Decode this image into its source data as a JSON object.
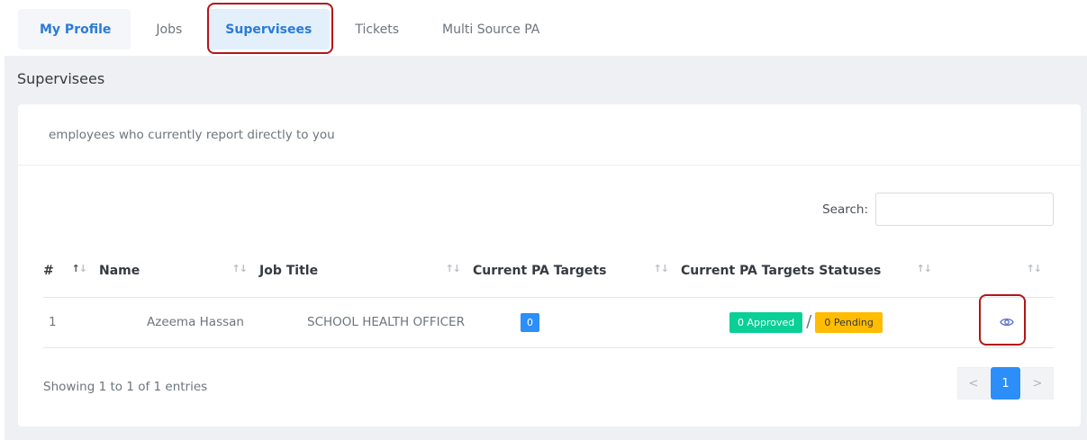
{
  "tabs": [
    {
      "label": "My Profile"
    },
    {
      "label": "Jobs"
    },
    {
      "label": "Supervisees"
    },
    {
      "label": "Tickets"
    },
    {
      "label": "Multi Source PA"
    }
  ],
  "section": {
    "title": "Supervisees",
    "description": "employees who currently report directly to you"
  },
  "search": {
    "label": "Search:",
    "value": ""
  },
  "table": {
    "headers": [
      "#",
      "Name",
      "Job Title",
      "Current PA Targets",
      "Current PA Targets Statuses",
      ""
    ],
    "rows": [
      {
        "index": "1",
        "name": "Azeema Hassan",
        "job_title": "SCHOOL HEALTH OFFICER",
        "targets": "0",
        "approved": "0 Approved",
        "separator": "/",
        "pending": "0 Pending",
        "action_icon": "eye-icon"
      }
    ]
  },
  "footer": {
    "info": "Showing 1 to 1 of 1 entries"
  },
  "pagination": {
    "prev": "<",
    "current": "1",
    "next": ">"
  },
  "colors": {
    "accent": "#2c8ef8",
    "approved": "#0acf97",
    "pending": "#ffbc00",
    "highlight": "#b3151b"
  }
}
